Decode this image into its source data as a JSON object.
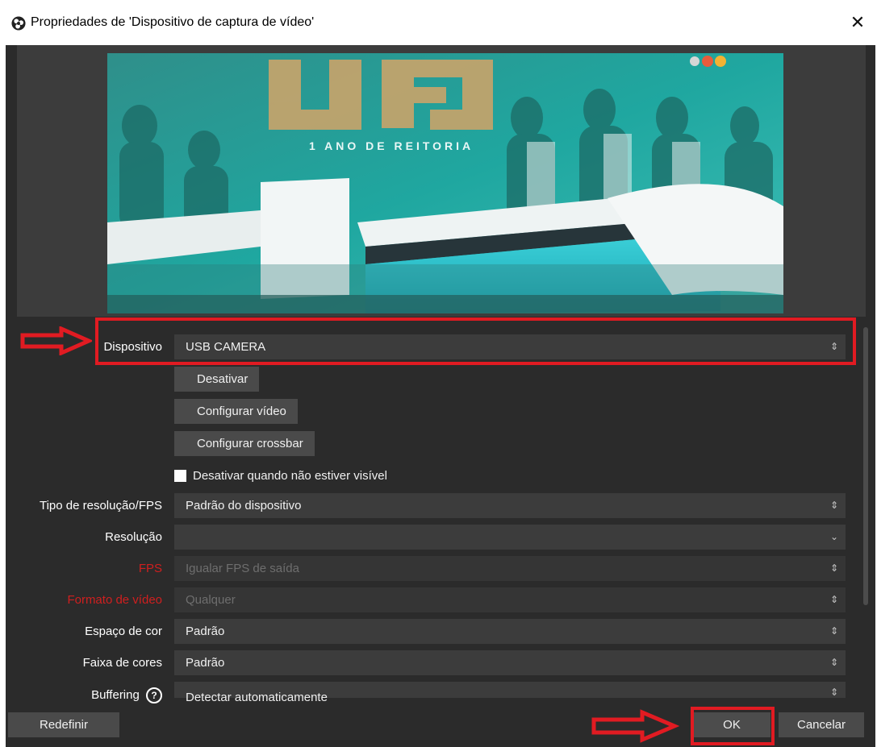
{
  "window": {
    "title": "Propriedades de 'Dispositivo de captura de vídeo'",
    "close_glyph": "✕"
  },
  "properties": {
    "device": {
      "label": "Dispositivo",
      "value": "USB CAMERA"
    },
    "buttons": {
      "deactivate": "Desativar",
      "configure_video": "Configurar vídeo",
      "configure_crossbar": "Configurar crossbar"
    },
    "deactivate_when_hidden": {
      "label": "Desativar quando não estiver visível",
      "checked": false
    },
    "resolution_fps_type": {
      "label": "Tipo de resolução/FPS",
      "value": "Padrão do dispositivo"
    },
    "resolution": {
      "label": "Resolução",
      "value": ""
    },
    "fps": {
      "label": "FPS",
      "value": "Igualar FPS de saída"
    },
    "video_format": {
      "label": "Formato de vídeo",
      "value": "Qualquer"
    },
    "color_space": {
      "label": "Espaço de cor",
      "value": "Padrão"
    },
    "color_range": {
      "label": "Faixa de cores",
      "value": "Padrão"
    },
    "buffering": {
      "label": "Buffering",
      "value": "Detectar automaticamente"
    }
  },
  "footer": {
    "reset": "Redefinir",
    "ok": "OK",
    "cancel": "Cancelar"
  },
  "preview": {
    "overlay_big": "UFJ",
    "overlay_small": "1 ANO DE REITORIA"
  },
  "colors": {
    "background": "#2b2b2b",
    "control": "#3c3c3c",
    "button": "#4a4a4a",
    "highlight": "#e11b22",
    "error_label": "#d01f1f",
    "preview_tint": "#1fa7a0"
  },
  "icons": {
    "app": "obs-logo-icon",
    "close": "close-icon",
    "combo": "updown-arrows-icon",
    "dropdown": "chevron-down-icon",
    "help": "question-circle-icon",
    "annotation": "arrow-right-annotation"
  }
}
